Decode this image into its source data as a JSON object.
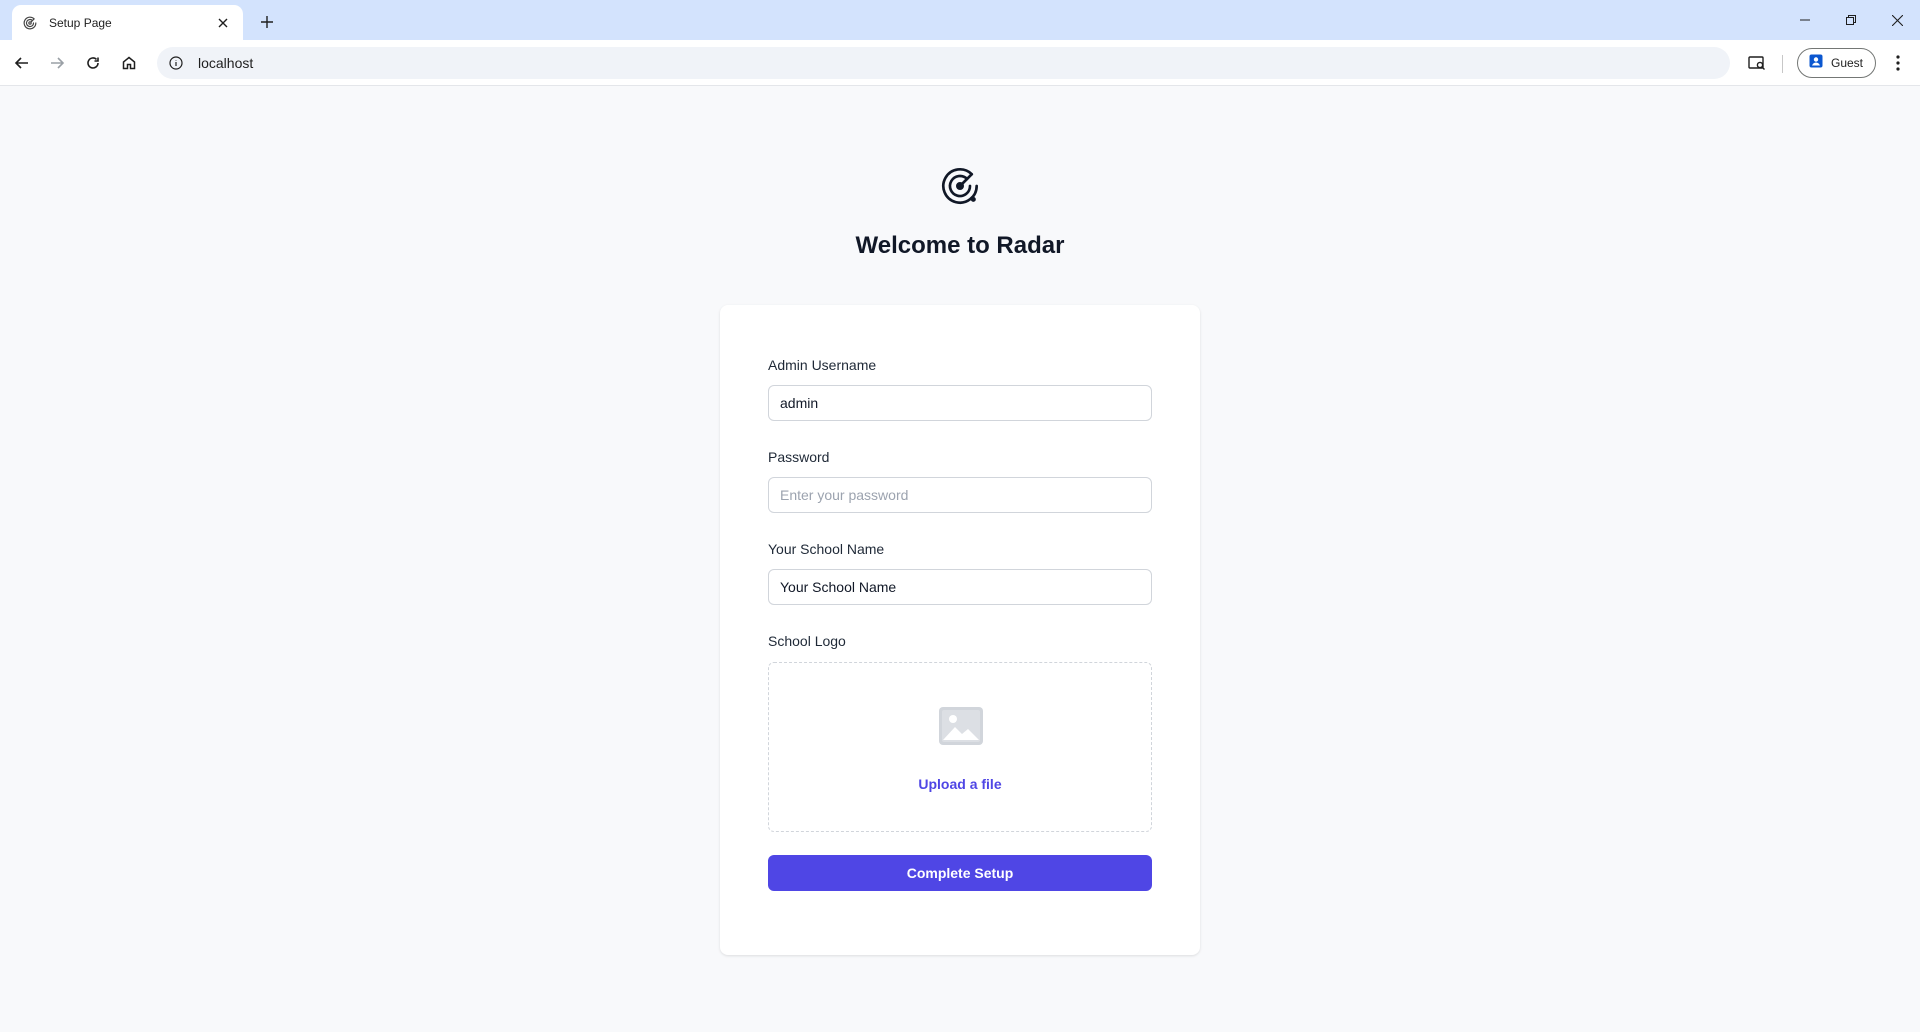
{
  "browser": {
    "tab": {
      "title": "Setup Page",
      "favicon": "radar-icon"
    },
    "address": {
      "url": "localhost"
    },
    "profile": {
      "label": "Guest"
    }
  },
  "page": {
    "logo_icon": "radar-icon",
    "title": "Welcome to Radar",
    "form": {
      "username": {
        "label": "Admin Username",
        "value": "admin"
      },
      "password": {
        "label": "Password",
        "value": "",
        "placeholder": "Enter your password"
      },
      "school_name": {
        "label": "Your School Name",
        "value": "Your School Name"
      },
      "school_logo": {
        "label": "School Logo",
        "upload_text": "Upload a file",
        "icon": "image-placeholder-icon"
      },
      "submit_label": "Complete Setup"
    }
  },
  "colors": {
    "accent": "#4f46e5",
    "page_background": "#f8f9fb",
    "tabstrip": "#d3e3fd"
  }
}
